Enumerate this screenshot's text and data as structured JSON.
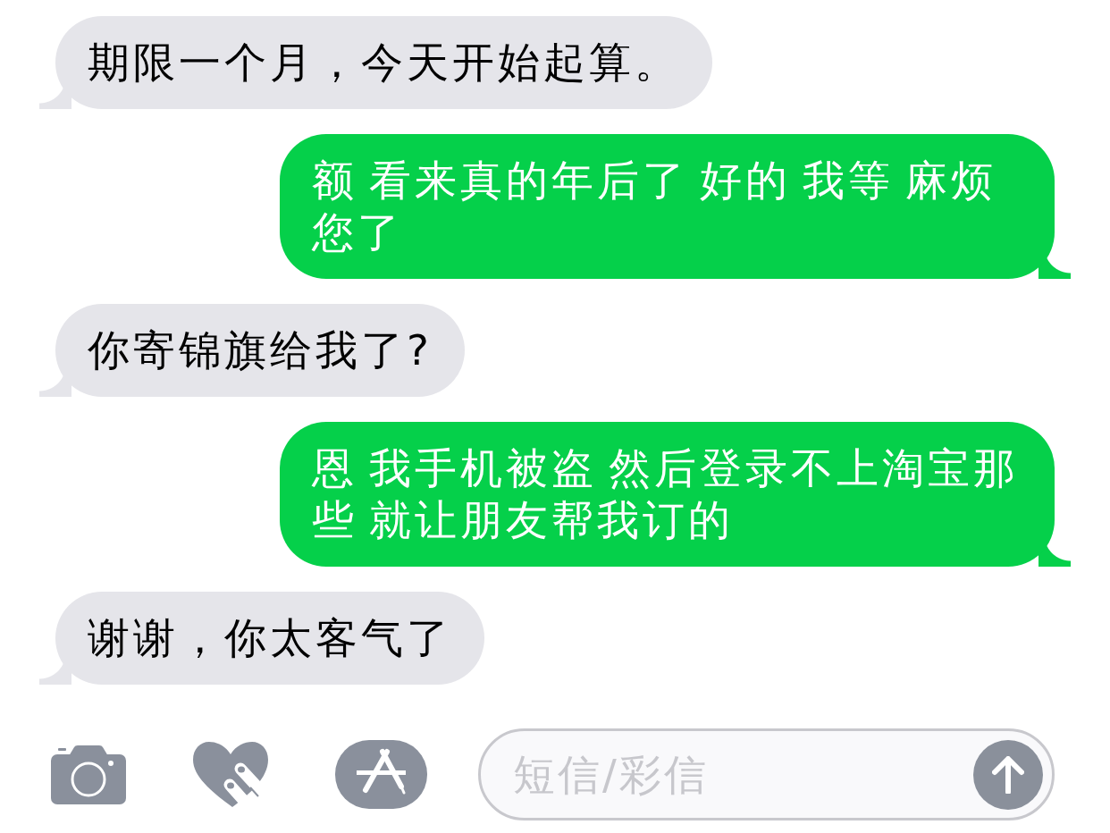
{
  "messages": [
    {
      "kind": "received",
      "text": "期限一个月，今天开始起算。"
    },
    {
      "kind": "sent",
      "text": "额 看来真的年后了 好的 我等 麻烦您了"
    },
    {
      "kind": "received",
      "text": "你寄锦旗给我了?"
    },
    {
      "kind": "sent",
      "text": "恩 我手机被盗 然后登录不上淘宝那些 就让朋友帮我订的"
    },
    {
      "kind": "received",
      "text": "谢谢，你太客气了"
    }
  ],
  "composer": {
    "placeholder": "短信/彩信"
  }
}
